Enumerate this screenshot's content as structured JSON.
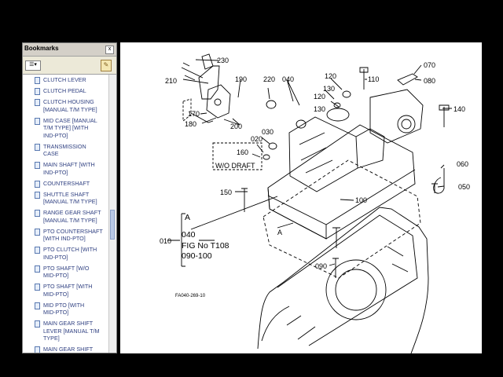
{
  "bookmarks": {
    "title": "Bookmarks",
    "close_glyph": "x",
    "options_glyph": "☰▾",
    "items": [
      "CLUTCH LEVER",
      "CLUTCH PEDAL",
      "CLUTCH HOUSING\n[MANUAL T/M TYPE]",
      "MID CASE [MANUAL\nT/M TYPE] [WITH\nIND-PTO]",
      "TRANSMISSION\nCASE",
      "MAIN SHAFT [WITH\nIND-PTO]",
      "COUNTERSHAFT",
      "SHUTTLE SHAFT\n[MANUAL T/M TYPE]",
      "RANGE GEAR SHAFT\n[MANUAL T/M TYPE]",
      "PTO COUNTERSHAFT\n[WITH IND-PTO]",
      "PTO CLUTCH [WITH\nIND-PTO]",
      "PTO SHAFT [W/O\nMID-PTO]",
      "PTO SHAFT [WITH\nMID-PTO]",
      "MID PTO [WITH\nMID-PTO]",
      "MAIN GEAR SHIFT\nLEVER [MANUAL T/M\nTYPE]",
      "MAIN GEAR SHIFT"
    ]
  },
  "diagram": {
    "part_labels": {
      "p230": "230",
      "p210": "210",
      "p190": "190",
      "p220": "220",
      "p040": "040",
      "p120a": "120",
      "p110": "110",
      "p070": "070",
      "p080": "080",
      "p130a": "130",
      "p120b": "120",
      "p130b": "130",
      "p140": "140",
      "p170": "170",
      "p180": "180",
      "p200": "200",
      "p030": "030",
      "p020": "020",
      "p160": "160",
      "p060": "060",
      "p050": "050",
      "p150": "150",
      "p100": "100",
      "p090": "090",
      "p010": "010"
    },
    "wo_draft": "W/O DRAFT",
    "marker_a": "A",
    "callout_a": "A",
    "callout_040": "040",
    "fig_no": "FIG No T108",
    "fig_range": "090-100",
    "drawing_code": "FA040-269-10"
  }
}
